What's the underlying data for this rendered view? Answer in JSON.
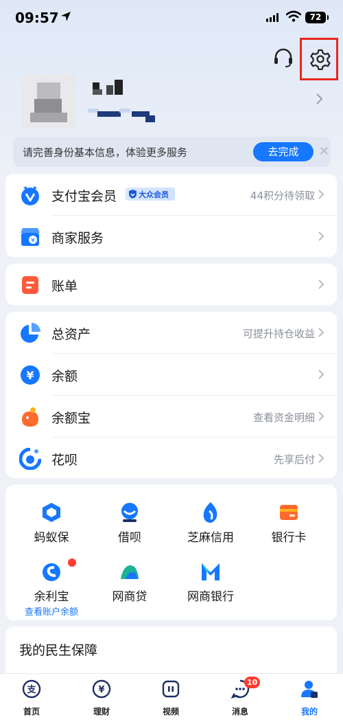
{
  "status_bar": {
    "time": "09:57",
    "battery": "72"
  },
  "header": {
    "support_icon": "headset-icon",
    "settings_icon": "gear-icon"
  },
  "profile": {
    "avatar": "blurred-avatar",
    "name": "",
    "account": ""
  },
  "notice": {
    "text": "请完善身份基本信息，体验更多服务",
    "button": "去完成"
  },
  "group1": [
    {
      "icon": "alipay-member-icon",
      "label": "支付宝会员",
      "badge": "大众会员",
      "hint": "44积分待领取"
    },
    {
      "icon": "merchant-icon",
      "label": "商家服务",
      "hint": ""
    }
  ],
  "group2": [
    {
      "icon": "bill-icon",
      "label": "账单",
      "hint": ""
    }
  ],
  "group3": [
    {
      "icon": "pie-chart-icon",
      "label": "总资产",
      "hint": "可提升持仓收益"
    },
    {
      "icon": "yuan-icon",
      "label": "余额",
      "hint": ""
    },
    {
      "icon": "yuebao-icon",
      "label": "余额宝",
      "hint": "查看资金明细"
    },
    {
      "icon": "huabei-icon",
      "label": "花呗",
      "hint": "先享后付"
    }
  ],
  "grid": [
    {
      "icon": "ant-insurance-icon",
      "label": "蚂蚁保",
      "sub": ""
    },
    {
      "icon": "jiebei-icon",
      "label": "借呗",
      "sub": ""
    },
    {
      "icon": "sesame-credit-icon",
      "label": "芝麻信用",
      "sub": ""
    },
    {
      "icon": "bank-card-icon",
      "label": "银行卡",
      "sub": ""
    },
    {
      "icon": "yulibao-icon",
      "label": "余利宝",
      "sub": "查看账户余额"
    },
    {
      "icon": "mybank-loan-icon",
      "label": "网商贷",
      "sub": ""
    },
    {
      "icon": "mybank-icon",
      "label": "网商银行",
      "sub": ""
    }
  ],
  "section": {
    "title": "我的民生保障"
  },
  "tabbar": [
    {
      "icon": "home-icon",
      "label": "首页"
    },
    {
      "icon": "wealth-icon",
      "label": "理财"
    },
    {
      "icon": "video-icon",
      "label": "视频"
    },
    {
      "icon": "message-icon",
      "label": "消息",
      "badge": "10"
    },
    {
      "icon": "profile-icon",
      "label": "我的",
      "active": true
    }
  ],
  "colors": {
    "accent": "#1677ff",
    "highlight_box": "#e8271c",
    "badge_red": "#ff3b30"
  }
}
